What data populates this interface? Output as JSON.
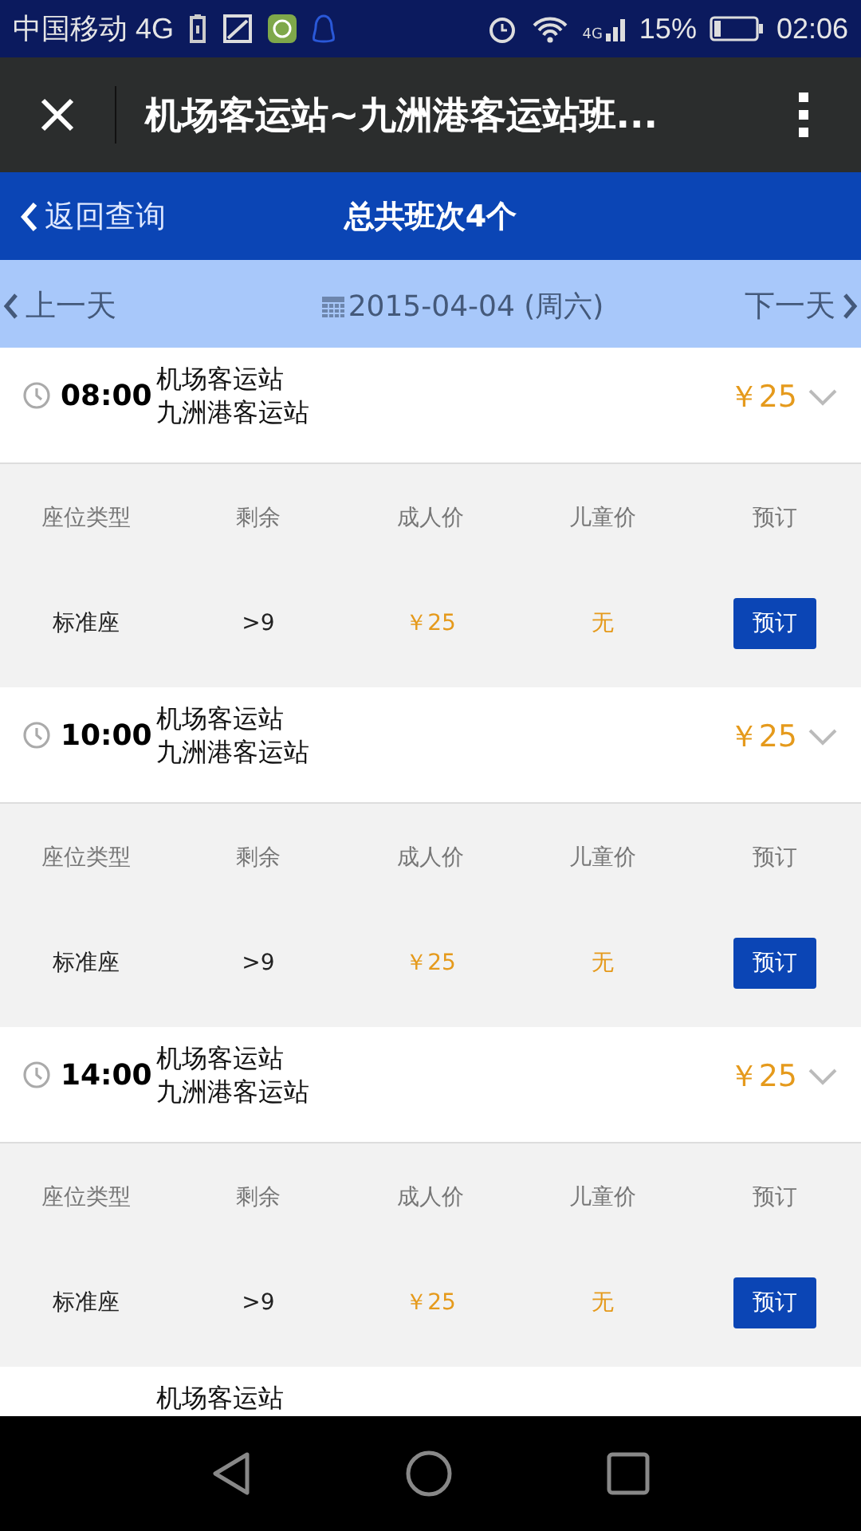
{
  "status_bar": {
    "carrier": "中国移动 4G",
    "network": "4G",
    "battery": "15%",
    "time": "02:06"
  },
  "app_bar": {
    "title": "机场客运站~九洲港客运站班..."
  },
  "header": {
    "back": "返回查询",
    "title": "总共班次4个"
  },
  "date_bar": {
    "prev": "上一天",
    "date": "2015-04-04 (周六)",
    "next": "下一天"
  },
  "trips": [
    {
      "time": "08:00",
      "origin": "机场客运站",
      "destination": "九洲港客运站",
      "price": "￥25",
      "expanded": true,
      "columns": [
        "座位类型",
        "剩余",
        "成人价",
        "儿童价",
        "预订"
      ],
      "seats": [
        {
          "type": "标准座",
          "remaining": ">9",
          "adult": "￥25",
          "child": "无",
          "book": "预订"
        }
      ]
    },
    {
      "time": "10:00",
      "origin": "机场客运站",
      "destination": "九洲港客运站",
      "price": "￥25",
      "expanded": true,
      "columns": [
        "座位类型",
        "剩余",
        "成人价",
        "儿童价",
        "预订"
      ],
      "seats": [
        {
          "type": "标准座",
          "remaining": ">9",
          "adult": "￥25",
          "child": "无",
          "book": "预订"
        }
      ]
    },
    {
      "time": "14:00",
      "origin": "机场客运站",
      "destination": "九洲港客运站",
      "price": "￥25",
      "expanded": true,
      "columns": [
        "座位类型",
        "剩余",
        "成人价",
        "儿童价",
        "预订"
      ],
      "seats": [
        {
          "type": "标准座",
          "remaining": ">9",
          "adult": "￥25",
          "child": "无",
          "book": "预订"
        }
      ]
    },
    {
      "origin": "机场客运站",
      "expanded": false
    }
  ]
}
